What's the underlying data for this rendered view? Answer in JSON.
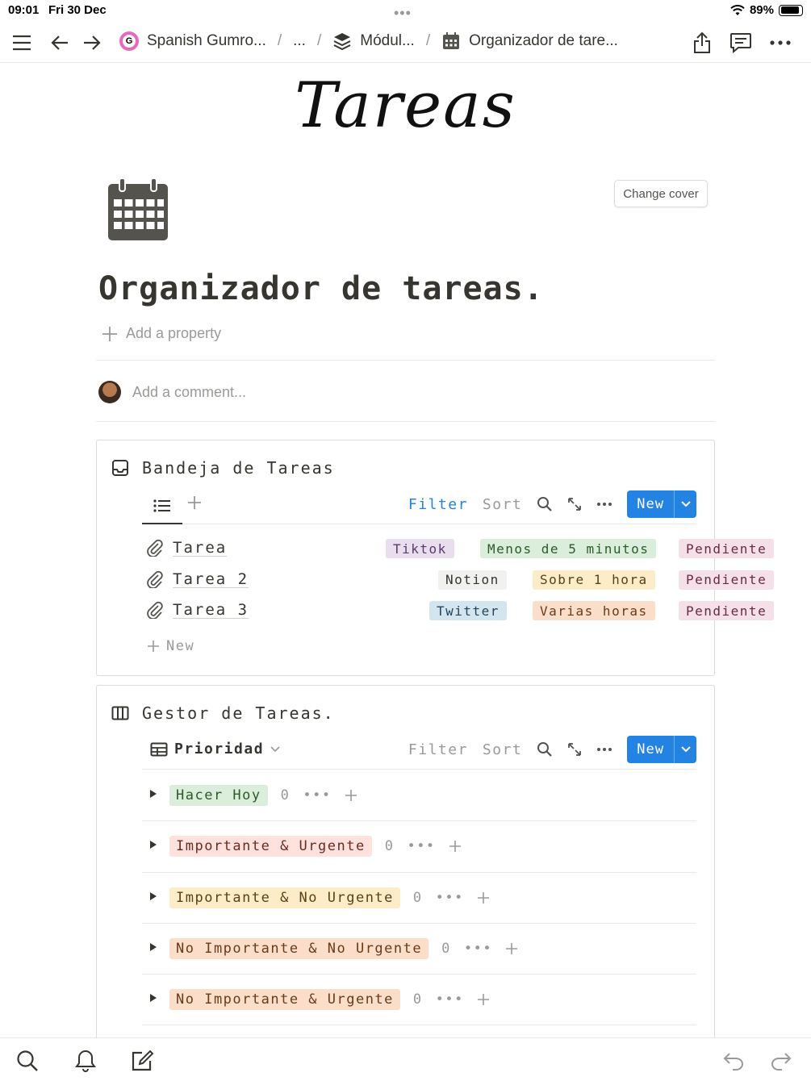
{
  "status": {
    "time": "09:01",
    "date": "Fri 30 Dec",
    "battery": "89%",
    "battery_level": 0.89
  },
  "breadcrumb": {
    "items": [
      {
        "label": "Spanish Gumro...",
        "icon": "gumroad-g-icon"
      },
      {
        "label": "..."
      },
      {
        "label": "Módul...",
        "icon": "layers-icon"
      },
      {
        "label": "Organizador de tare...",
        "icon": "calendar-icon"
      }
    ],
    "separator": "/"
  },
  "cover": {
    "title": "Tareas",
    "change_cover_label": "Change cover"
  },
  "page": {
    "icon": "calendar-icon",
    "title": "Organizador de tareas.",
    "add_property_label": "Add a property",
    "add_comment_placeholder": "Add a comment..."
  },
  "inbox": {
    "title": "Bandeja de Tareas",
    "icon": "inbox-icon",
    "filter_label": "Filter",
    "sort_label": "Sort",
    "new_label": "New",
    "new_row_label": "New",
    "rows": [
      {
        "name": "Tarea",
        "tags": [
          {
            "text": "Tiktok",
            "bg": "#e8deee",
            "fg": "#5a3a6a"
          },
          {
            "text": "Menos de 5 minutos",
            "bg": "#dbeddb",
            "fg": "#2b5a2b"
          },
          {
            "text": "Pendiente",
            "bg": "#f5e0e9",
            "fg": "#6b2a40"
          }
        ]
      },
      {
        "name": "Tarea 2",
        "tags": [
          {
            "text": "Notion",
            "bg": "#f1f1ef",
            "fg": "#37352f"
          },
          {
            "text": "Sobre 1 hora",
            "bg": "#fdecc8",
            "fg": "#5a4116"
          },
          {
            "text": "Pendiente",
            "bg": "#f5e0e9",
            "fg": "#6b2a40"
          }
        ]
      },
      {
        "name": "Tarea 3",
        "tags": [
          {
            "text": "Twitter",
            "bg": "#d3e5ef",
            "fg": "#24465a"
          },
          {
            "text": "Varias horas",
            "bg": "#fadec9",
            "fg": "#6a3a1a"
          },
          {
            "text": "Pendiente",
            "bg": "#f5e0e9",
            "fg": "#6b2a40"
          }
        ]
      }
    ]
  },
  "manager": {
    "title": "Gestor de Tareas.",
    "icon": "board-icon",
    "view_label": "Prioridad",
    "filter_label": "Filter",
    "sort_label": "Sort",
    "new_label": "New",
    "groups": [
      {
        "label": "Hacer Hoy",
        "count": "0",
        "bg": "#dbeddb",
        "fg": "#2b5a2b"
      },
      {
        "label": "Importante & Urgente",
        "count": "0",
        "bg": "#ffe2dd",
        "fg": "#6e2a22"
      },
      {
        "label": "Importante & No Urgente",
        "count": "0",
        "bg": "#fdecc8",
        "fg": "#5a4116"
      },
      {
        "label": "No Importante & No Urgente",
        "count": "0",
        "bg": "#fadec9",
        "fg": "#6a3a1a"
      },
      {
        "label": "No Importante & Urgente",
        "count": "0",
        "bg": "#fadec9",
        "fg": "#6a3a1a"
      }
    ]
  },
  "colors": {
    "accent": "#2383e2",
    "text": "#37352f",
    "muted": "#9b9a97"
  }
}
